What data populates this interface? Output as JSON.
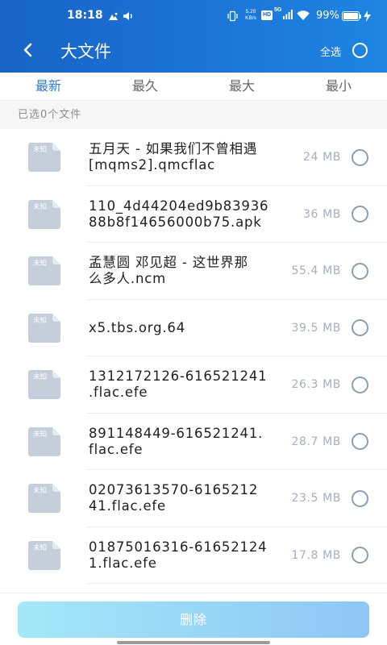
{
  "status_bar": {
    "time": "18:18",
    "net_speed": {
      "value": "5.20",
      "unit": "KB/s"
    },
    "hd_badge": "HD",
    "network_type": "5G",
    "battery_percent": "99%",
    "battery_level": 0.99,
    "charging": true,
    "icons": {
      "notification": "gallery-notification-icon",
      "volume": "volume-icon",
      "vibrate": "vibrate-icon",
      "signal": "signal-icon",
      "wifi": "wifi-icon",
      "battery": "battery-icon",
      "charging": "charging-icon"
    }
  },
  "header": {
    "title": "大文件",
    "back_icon": "chevron-left-icon",
    "select_all_label": "全选",
    "select_all_checked": false
  },
  "tabs": [
    {
      "label": "最新",
      "active": true
    },
    {
      "label": "最久",
      "active": false
    },
    {
      "label": "最大",
      "active": false
    },
    {
      "label": "最小",
      "active": false
    }
  ],
  "selection_summary": "已选0个文件",
  "files": [
    {
      "icon_label": "未知",
      "name_lines": [
        "五月天 - 如果我们不曾相遇",
        "[mqms2].qmcflac"
      ],
      "size": "24 MB",
      "selected": false
    },
    {
      "icon_label": "未知",
      "name_lines": [
        "110_4d44204ed9b83936",
        "88b8f14656000b75.apk"
      ],
      "size": "36 MB",
      "selected": false
    },
    {
      "icon_label": "未知",
      "name_lines": [
        "孟慧圆 邓见超 - 这世界那",
        "么多人.ncm"
      ],
      "size": "55.4 MB",
      "selected": false
    },
    {
      "icon_label": "未知",
      "name_lines": [
        "x5.tbs.org.64"
      ],
      "size": "39.5 MB",
      "selected": false
    },
    {
      "icon_label": "未知",
      "name_lines": [
        "1312172126-616521241",
        ".flac.efe"
      ],
      "size": "26.3 MB",
      "selected": false
    },
    {
      "icon_label": "未知",
      "name_lines": [
        "891148449-616521241.",
        "flac.efe"
      ],
      "size": "28.7 MB",
      "selected": false
    },
    {
      "icon_label": "未知",
      "name_lines": [
        "02073613570-6165212",
        "41.flac.efe"
      ],
      "size": "23.5 MB",
      "selected": false
    },
    {
      "icon_label": "未知",
      "name_lines": [
        "01875016316-61652124",
        "1.flac.efe"
      ],
      "size": "17.8 MB",
      "selected": false
    }
  ],
  "footer": {
    "delete_label": "删除",
    "enabled": false
  },
  "colors": {
    "header_gradient_start": "#1763C6",
    "header_gradient_end": "#1F84E3",
    "accent": "#2A7DE1",
    "file_icon": "#C5CFDB",
    "size_text": "#A6AFBD",
    "radio_border": "#8D9CB0",
    "delete_gradient_start": "#A3E8F8",
    "delete_gradient_end": "#8FC6F5"
  }
}
